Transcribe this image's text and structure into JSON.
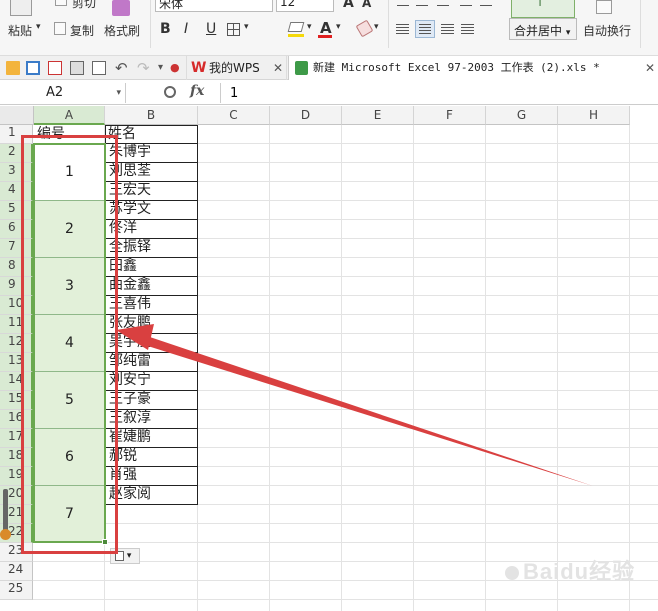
{
  "ribbon": {
    "cut_label": "剪切",
    "paste_label": "粘贴",
    "copy_label": "复制",
    "format_painter_label": "格式刷",
    "font_name": "宋体",
    "font_size": "12",
    "bold_label": "B",
    "italic_label": "I",
    "underline_label": "U",
    "font_color_label": "A",
    "merge_center_label": "合并居中",
    "wrap_text_label": "自动换行"
  },
  "tabs": [
    {
      "label": "我的WPS"
    },
    {
      "label": "新建 Microsoft Excel 97-2003 工作表 (2).xls *"
    }
  ],
  "formula_bar": {
    "name_box": "A2",
    "fx_label": "fx",
    "value": "1"
  },
  "columns": [
    "A",
    "B",
    "C",
    "D",
    "E",
    "F",
    "G",
    "H"
  ],
  "rows": [
    "1",
    "2",
    "3",
    "4",
    "5",
    "6",
    "7",
    "8",
    "9",
    "10",
    "11",
    "12",
    "13",
    "14",
    "15",
    "16",
    "17",
    "18",
    "19",
    "20",
    "21",
    "22",
    "23",
    "24",
    "25"
  ],
  "sheet": {
    "header_a": "编号",
    "header_b": "姓名",
    "names": [
      "朱博宇",
      "刘思荃",
      "王宏天",
      "苏学文",
      "佟洋",
      "全振铎",
      "田鑫",
      "曲金鑫",
      "王喜伟",
      "张友鹏",
      "吴宇航",
      "邹纯雷",
      "刘安宁",
      "王子豪",
      "王叙淳",
      "崔婕鹏",
      "郝锐",
      "肖强",
      "赵家阅"
    ],
    "numbers": [
      "1",
      "2",
      "3",
      "4",
      "5",
      "6",
      "7"
    ]
  },
  "paste_options_label": "▾",
  "watermark": "Baidu经验",
  "colors": {
    "annotation": "#d94040",
    "selection": "#6aa84f",
    "merged_fill": "#e2f0d9"
  }
}
